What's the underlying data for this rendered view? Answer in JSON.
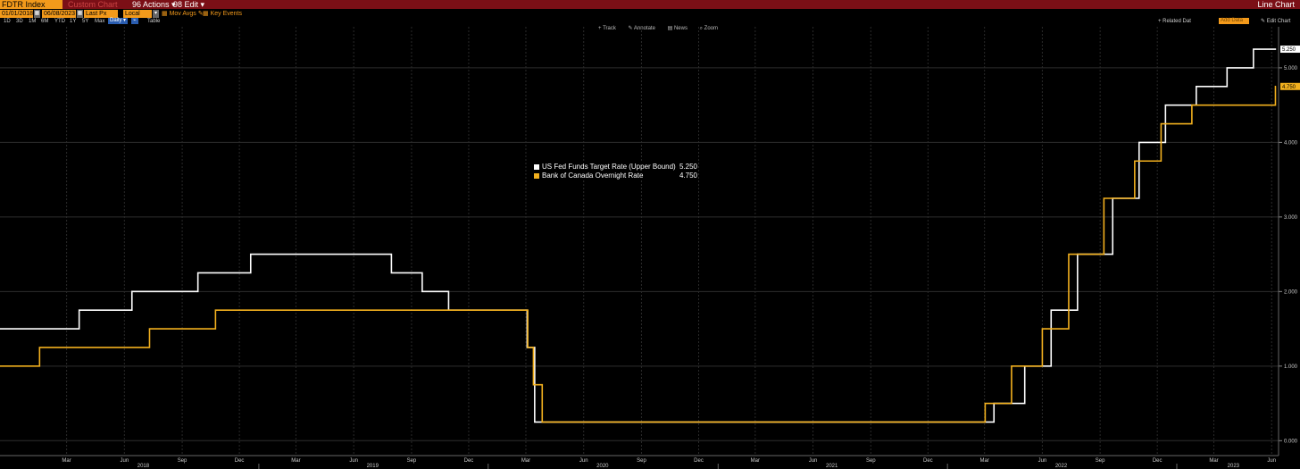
{
  "header": {
    "ticker": "FDTR Index",
    "ghost_text": "Custom Chart",
    "actions_label": "96 Actions ▾",
    "edit_label": "98 Edit ▾",
    "chart_type": "Line Chart"
  },
  "controls": {
    "start_date": "01/01/2018",
    "end_date": "06/08/2023",
    "field": "Last Px",
    "currency": "Local CCY",
    "mov_avgs": "Mov Avgs",
    "key_events": "Key Events",
    "ranges": [
      "1D",
      "3D",
      "1M",
      "6M",
      "YTD",
      "1Y",
      "5Y",
      "Max"
    ],
    "frequency": "Daily",
    "table": "Table",
    "related_data": "+ Related Dat",
    "add_data": "Add Data",
    "edit_chart": "Edit Chart"
  },
  "tools": [
    "Track",
    "Annotate",
    "News",
    "Zoom"
  ],
  "colors": {
    "fed": "#ffffff",
    "boc": "#f2b01e",
    "header_bg": "#7b0f16",
    "accent": "#f39a1b"
  },
  "chart_data": {
    "type": "line",
    "step": true,
    "ylim": [
      -0.2,
      5.55
    ],
    "y_ticks": [
      "0.000",
      "1.000",
      "2.000",
      "3.000",
      "4.000",
      "5.000"
    ],
    "y_axis_position": "right",
    "x_range": [
      "2017-11-15",
      "2023-06-12"
    ],
    "month_ticks": [
      "Mar",
      "Jun",
      "Sep",
      "Dec",
      "Mar",
      "Jun",
      "Sep",
      "Dec",
      "Mar",
      "Jun",
      "Sep",
      "Dec",
      "Mar",
      "Jun",
      "Sep",
      "Dec",
      "Mar",
      "Jun",
      "Sep",
      "Dec",
      "Mar",
      "Jun"
    ],
    "month_tick_dates": [
      "2018-03-01",
      "2018-06-01",
      "2018-09-01",
      "2018-12-01",
      "2019-03-01",
      "2019-06-01",
      "2019-09-01",
      "2019-12-01",
      "2020-03-01",
      "2020-06-01",
      "2020-09-01",
      "2020-12-01",
      "2021-03-01",
      "2021-06-01",
      "2021-09-01",
      "2021-12-01",
      "2022-03-01",
      "2022-06-01",
      "2022-09-01",
      "2022-12-01",
      "2023-03-01",
      "2023-06-01"
    ],
    "year_labels": [
      "2018",
      "2019",
      "2020",
      "2021",
      "2022",
      "2023"
    ],
    "year_label_dates": [
      "2018-07-01",
      "2019-07-01",
      "2020-07-01",
      "2021-07-01",
      "2022-07-01",
      "2023-04-01"
    ],
    "grid": true,
    "legend_position": "center",
    "series": [
      {
        "name": "US Fed Funds Target Rate (Upper Bound)",
        "last_label": "5.250",
        "points": [
          [
            "2017-11-15",
            1.5
          ],
          [
            "2018-03-21",
            1.75
          ],
          [
            "2018-06-13",
            2.0
          ],
          [
            "2018-09-26",
            2.25
          ],
          [
            "2018-12-19",
            2.5
          ],
          [
            "2019-07-31",
            2.25
          ],
          [
            "2019-09-18",
            2.0
          ],
          [
            "2019-10-30",
            1.75
          ],
          [
            "2020-03-03",
            1.25
          ],
          [
            "2020-03-15",
            0.25
          ],
          [
            "2022-03-16",
            0.5
          ],
          [
            "2022-05-04",
            1.0
          ],
          [
            "2022-06-15",
            1.75
          ],
          [
            "2022-07-27",
            2.5
          ],
          [
            "2022-09-21",
            3.25
          ],
          [
            "2022-11-02",
            4.0
          ],
          [
            "2022-12-14",
            4.5
          ],
          [
            "2023-02-01",
            4.75
          ],
          [
            "2023-03-22",
            5.0
          ],
          [
            "2023-05-03",
            5.25
          ],
          [
            "2023-06-08",
            5.25
          ]
        ]
      },
      {
        "name": "Bank of Canada Overnight Rate",
        "last_label": "4.750",
        "points": [
          [
            "2017-11-15",
            1.0
          ],
          [
            "2018-01-17",
            1.25
          ],
          [
            "2018-07-11",
            1.5
          ],
          [
            "2018-10-24",
            1.75
          ],
          [
            "2020-03-04",
            1.25
          ],
          [
            "2020-03-13",
            0.75
          ],
          [
            "2020-03-27",
            0.25
          ],
          [
            "2022-03-02",
            0.5
          ],
          [
            "2022-04-13",
            1.0
          ],
          [
            "2022-06-01",
            1.5
          ],
          [
            "2022-07-13",
            2.5
          ],
          [
            "2022-09-07",
            3.25
          ],
          [
            "2022-10-26",
            3.75
          ],
          [
            "2022-12-07",
            4.25
          ],
          [
            "2023-01-25",
            4.5
          ],
          [
            "2023-06-07",
            4.75
          ],
          [
            "2023-06-08",
            4.75
          ]
        ]
      }
    ]
  }
}
